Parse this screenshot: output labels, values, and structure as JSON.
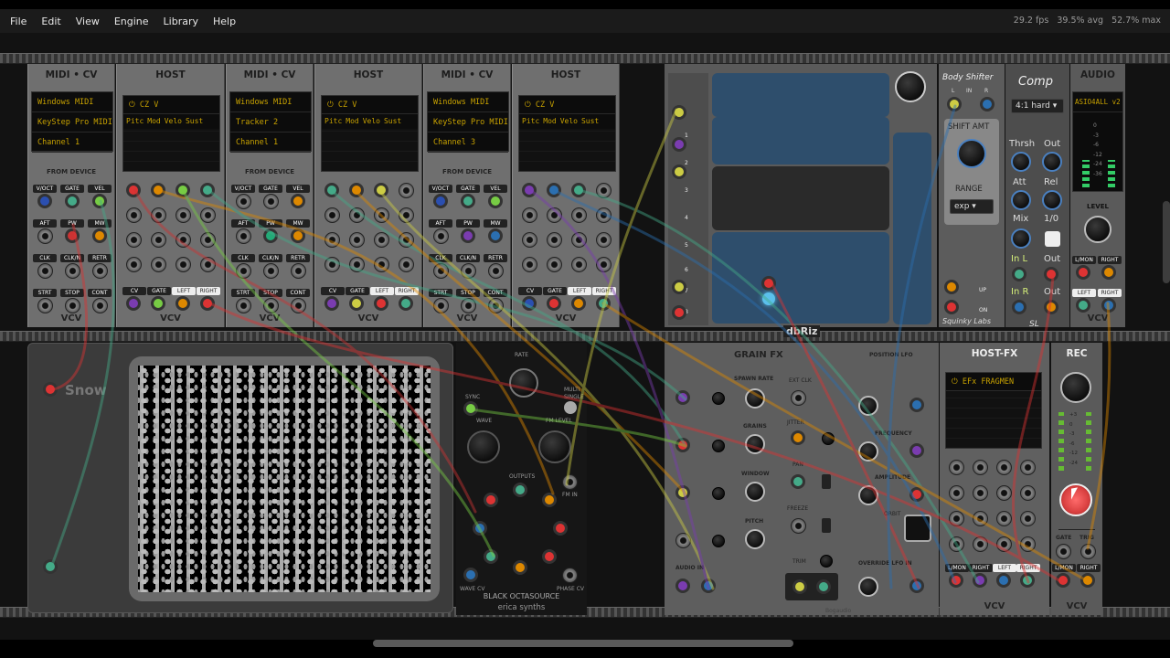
{
  "menu": {
    "items": [
      "File",
      "Edit",
      "View",
      "Engine",
      "Library",
      "Help"
    ]
  },
  "perf": {
    "fps": "29.2 fps",
    "avg": "39.5% avg",
    "max": "52.7% max"
  },
  "midicv": [
    {
      "title": "MIDI • CV",
      "driver": "Windows MIDI",
      "device": "KeyStep Pro MIDI IN",
      "channel": "Channel 1",
      "section": "FROM DEVICE",
      "brand": "VCV"
    },
    {
      "title": "MIDI • CV",
      "driver": "Windows MIDI",
      "device": "Tracker 2",
      "channel": "Channel 1",
      "section": "FROM DEVICE",
      "brand": "VCV"
    },
    {
      "title": "MIDI • CV",
      "driver": "Windows MIDI",
      "device": "KeyStep Pro MIDI IN",
      "channel": "Channel 3",
      "section": "FROM DEVICE",
      "brand": "VCV"
    }
  ],
  "midi_jack_labels": [
    "V/OCT",
    "GATE",
    "VEL",
    "AFT",
    "PW",
    "MW",
    "CLK",
    "CLK/N",
    "RETR",
    "STRT",
    "STOP",
    "CONT"
  ],
  "host": [
    {
      "title": "HOST",
      "plugin": "CZ V",
      "cols": [
        "Pitc",
        "Mod",
        "Velo",
        "Sust"
      ],
      "brand": "VCV",
      "bottom_labels": [
        "CV",
        "GATE",
        "LEFT",
        "RIGHT"
      ]
    },
    {
      "title": "HOST",
      "plugin": "CZ V",
      "cols": [
        "Pitc",
        "Mod",
        "Velo",
        "Sust"
      ],
      "brand": "VCV",
      "bottom_labels": [
        "CV",
        "GATE",
        "LEFT",
        "RIGHT"
      ]
    },
    {
      "title": "HOST",
      "plugin": "CZ V",
      "cols": [
        "Pitc",
        "Mod",
        "Velo",
        "Sust"
      ],
      "brand": "VCV",
      "bottom_labels": [
        "CV",
        "GATE",
        "LEFT",
        "RIGHT"
      ]
    }
  ],
  "sequencer": {
    "brand": "dbRiz",
    "left_numbers": [
      "1",
      "2",
      "3",
      "4",
      "5",
      "6",
      "7",
      "8"
    ]
  },
  "body_shifter": {
    "title": "Body Shifter",
    "inputs": [
      "L",
      "IN",
      "R"
    ],
    "shift_amt": "SHIFT AMT",
    "range_label": "RANGE",
    "range_value": "exp",
    "up": "UP",
    "on": "ON",
    "brand": "Squinky Labs"
  },
  "comp": {
    "title": "Comp",
    "mode": "4:1 hard",
    "labels": [
      "Thrsh",
      "Out",
      "Att",
      "Rel",
      "Mix",
      "1/0",
      "In L",
      "Out",
      "In R",
      "Out"
    ],
    "brand": "SL"
  },
  "audio": {
    "title": "AUDIO",
    "device": "ASIO4ALL v2",
    "meter_marks": [
      "0",
      "-3",
      "-6",
      "-12",
      "-24",
      "-36"
    ],
    "level": "LEVEL",
    "bottom_labels": [
      "L/MON",
      "RIGHT",
      "LEFT",
      "RIGHT"
    ],
    "brand": "VCV"
  },
  "snow": {
    "title": "Snow"
  },
  "octasource": {
    "labels": [
      "RATE",
      "SYNC",
      "WAVE",
      "MULTI",
      "SINGLE",
      "FM LEVEL",
      "OUTPUTS",
      "FM IN",
      "WAVE CV",
      "PHASE CV"
    ],
    "name": "BLACK OCTASOURCE",
    "brand": "erica synths"
  },
  "grain_fx": {
    "title": "GRAIN FX",
    "labels": [
      "SPAWN RATE",
      "EXT CLK",
      "GRAINS",
      "JITTER",
      "WINDOW",
      "PAN",
      "PITCH",
      "FREEZE",
      "AUDIO IN",
      "TRIM",
      "POSITION LFO",
      "FREQUENCY",
      "AMPLITUDE",
      "OVERRIDE LFO IN",
      "ORBIT"
    ],
    "brand": "Bogaudio"
  },
  "host_fx": {
    "title": "HOST-FX",
    "plugin": "EFx FRAGMEN",
    "bottom_labels": [
      "L/MON",
      "RIGHT",
      "LEFT",
      "RIGHT"
    ],
    "brand": "VCV"
  },
  "rec": {
    "title": "REC",
    "meter_marks": [
      "+3",
      "0",
      "-3",
      "-6",
      "-12",
      "-24"
    ],
    "labels": [
      "GATE",
      "TRIG",
      "L/MON",
      "RIGHT"
    ],
    "brand": "VCV"
  },
  "colors": {
    "accent_red": "#d94040",
    "amber": "#c8a200",
    "cable_green": "#4caf50"
  }
}
